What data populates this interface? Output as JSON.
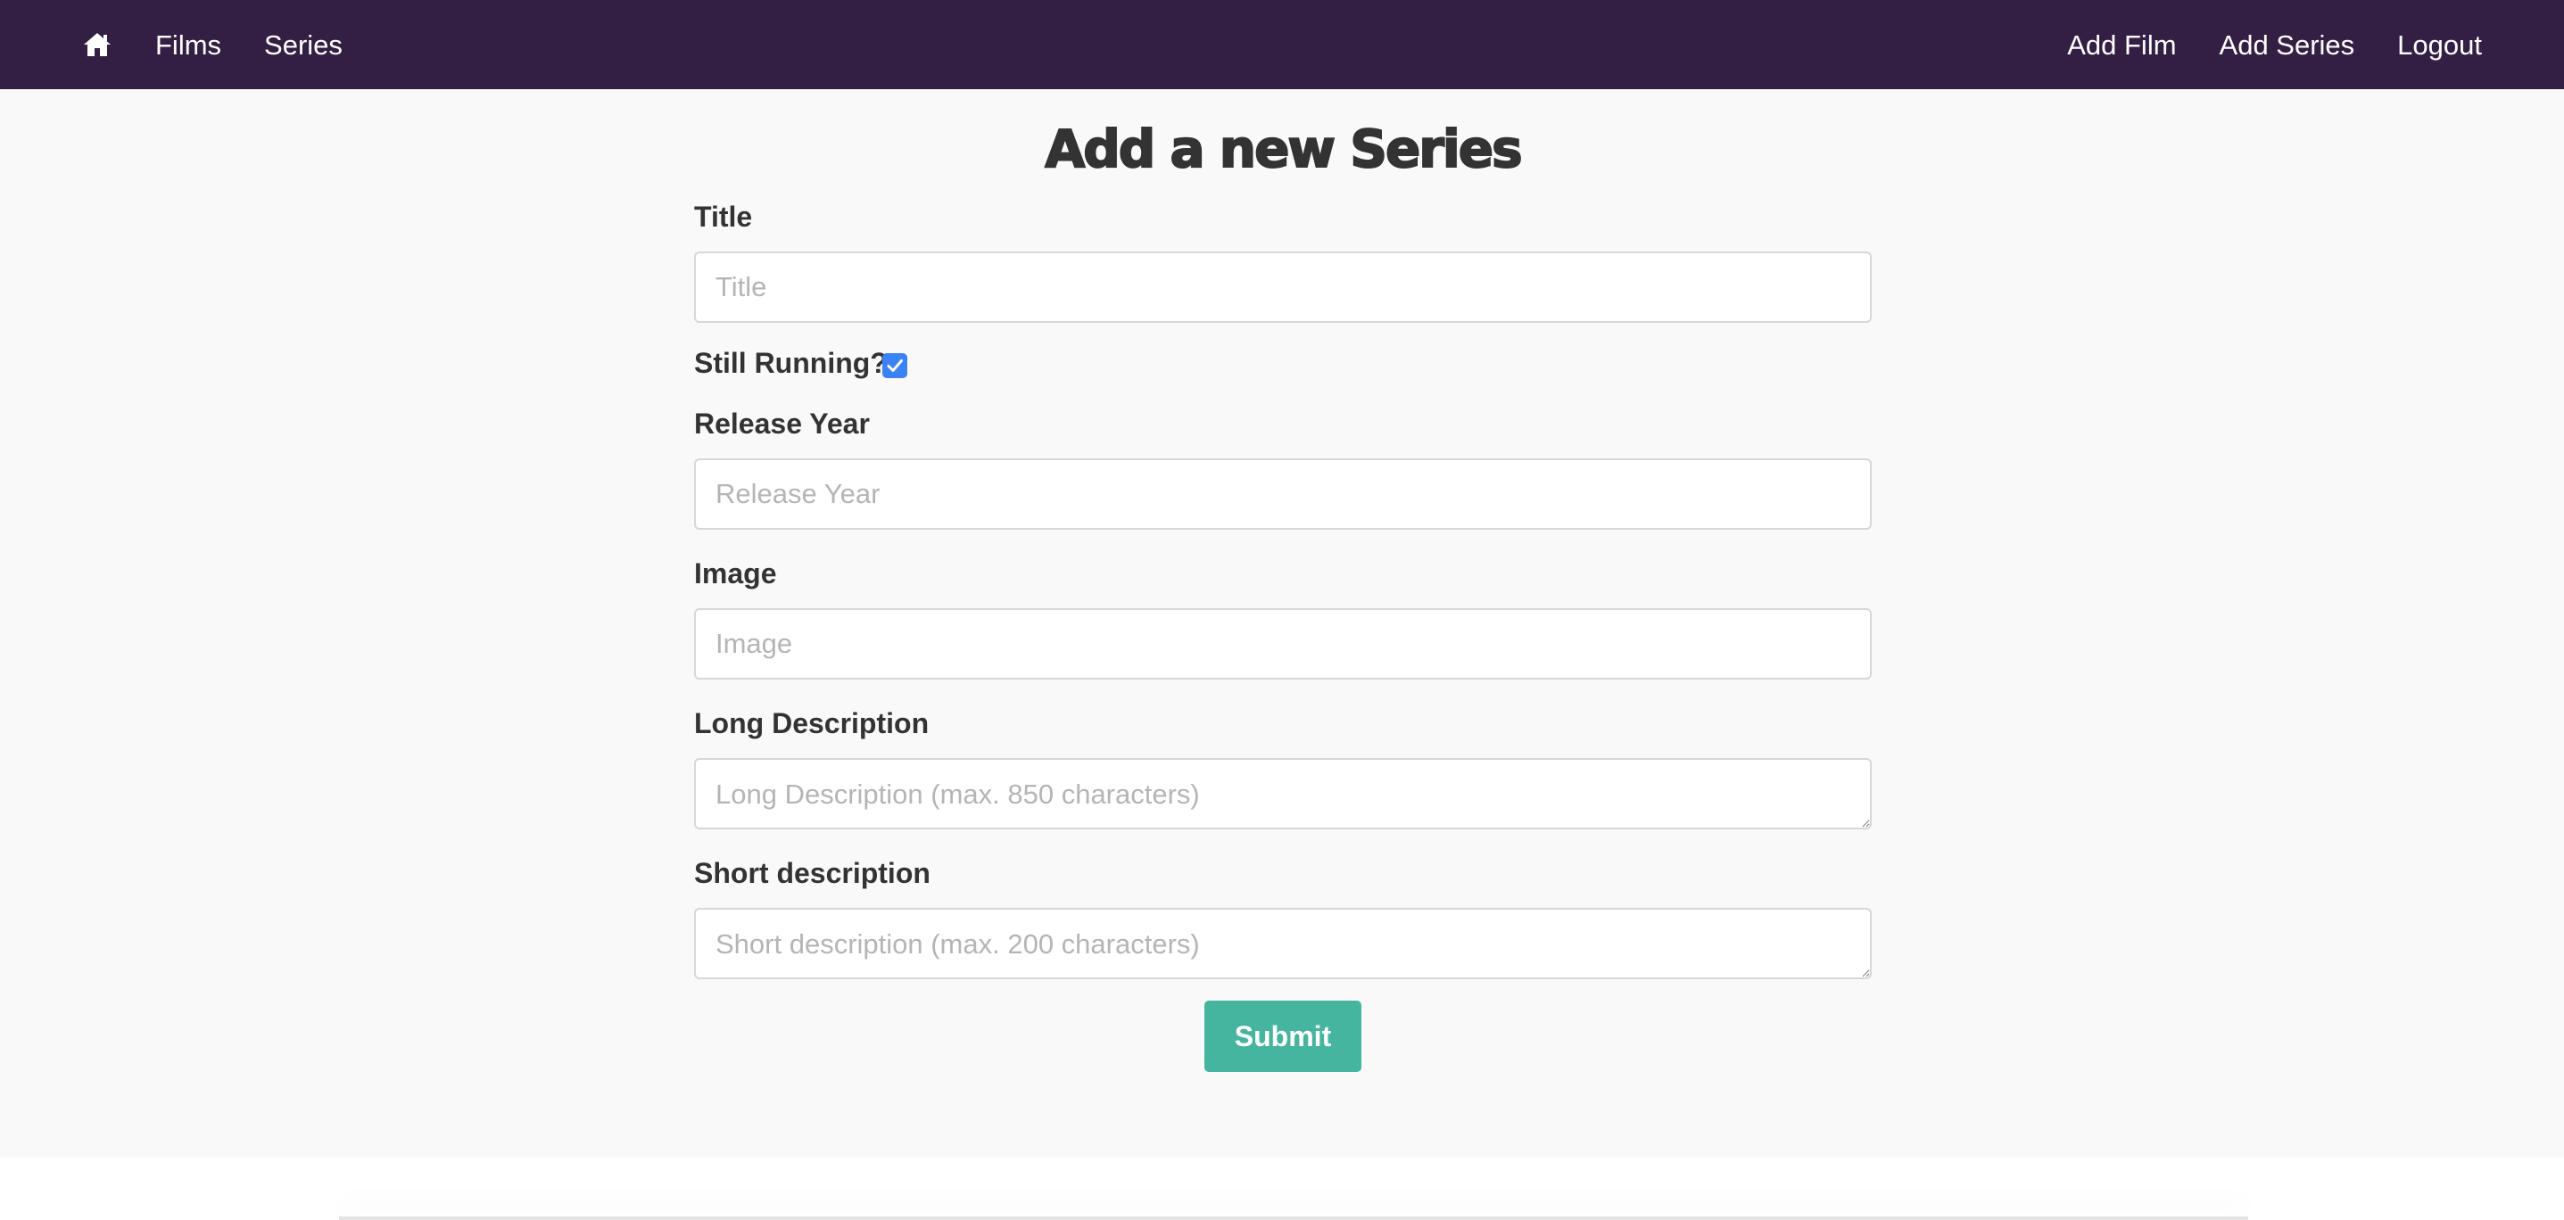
{
  "nav": {
    "home_icon": "home-icon",
    "films": "Films",
    "series": "Series",
    "add_film": "Add Film",
    "add_series": "Add Series",
    "logout": "Logout",
    "background_color": "#331f44"
  },
  "form": {
    "title": "Add a new Series",
    "title_label": "Title",
    "title_placeholder": "Title",
    "title_value": "",
    "still_running_label": "Still Running?",
    "still_running_checked": true,
    "release_year_label": "Release Year",
    "release_year_placeholder": "Release Year",
    "release_year_value": "",
    "image_label": "Image",
    "image_placeholder": "Image",
    "image_value": "",
    "long_description_label": "Long Description",
    "long_description_placeholder": "Long Description (max. 850 characters)",
    "long_description_value": "",
    "short_description_label": "Short description",
    "short_description_placeholder": "Short description (max. 200 characters)",
    "short_description_value": "",
    "submit_label": "Submit",
    "submit_color": "#45b5a0",
    "checkbox_color": "#3b82f6"
  }
}
